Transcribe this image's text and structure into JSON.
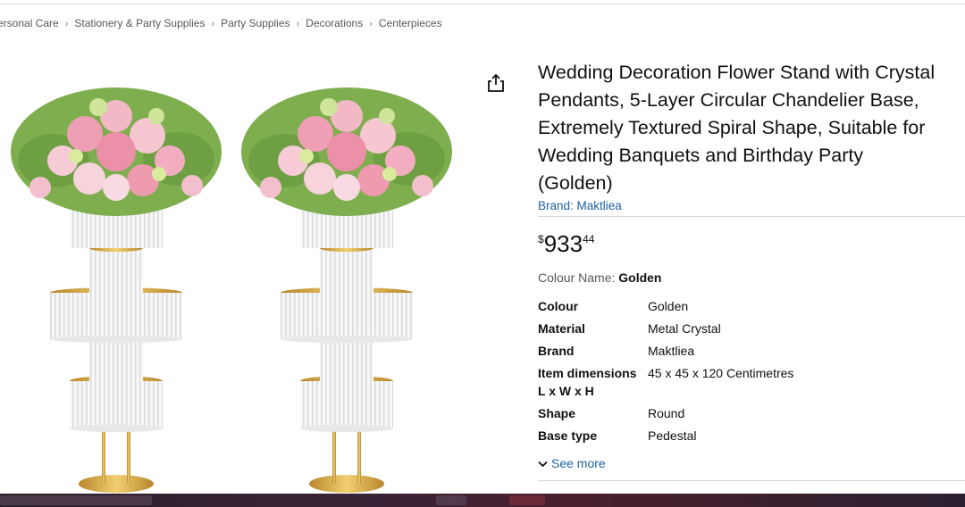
{
  "breadcrumb": {
    "items": [
      "ersonal Care",
      "Stationery & Party Supplies",
      "Party Supplies",
      "Decorations",
      "Centerpieces"
    ]
  },
  "product": {
    "title_lines": [
      "Wedding Decoration Flower Stand with Crystal",
      "Pendants, 5-Layer Circular Chandelier Base,",
      "Extremely Textured Spiral Shape, Suitable for",
      "Wedding Banquets and Birthday Party",
      "(Golden)"
    ],
    "brand_link": "Brand: Maktliea",
    "price": {
      "symbol": "$",
      "whole": "933",
      "fraction": "44"
    },
    "colour_name_label": "Colour Name:",
    "colour_name_value": "Golden",
    "specs": [
      {
        "key": "Colour",
        "value": "Golden"
      },
      {
        "key": "Material",
        "value": "Metal Crystal"
      },
      {
        "key": "Brand",
        "value": "Maktliea"
      },
      {
        "key": "Item dimensions L x W x H",
        "value": "45 x 45 x 120 Centimetres"
      },
      {
        "key": "Shape",
        "value": "Round"
      },
      {
        "key": "Base type",
        "value": "Pedestal"
      }
    ],
    "see_more": "See more"
  },
  "icons": {
    "share": "share-icon",
    "chevron": "chevron-down-icon"
  },
  "colors": {
    "link": "#2162a1",
    "text": "#0f1111",
    "gold": "#d9a53a"
  }
}
